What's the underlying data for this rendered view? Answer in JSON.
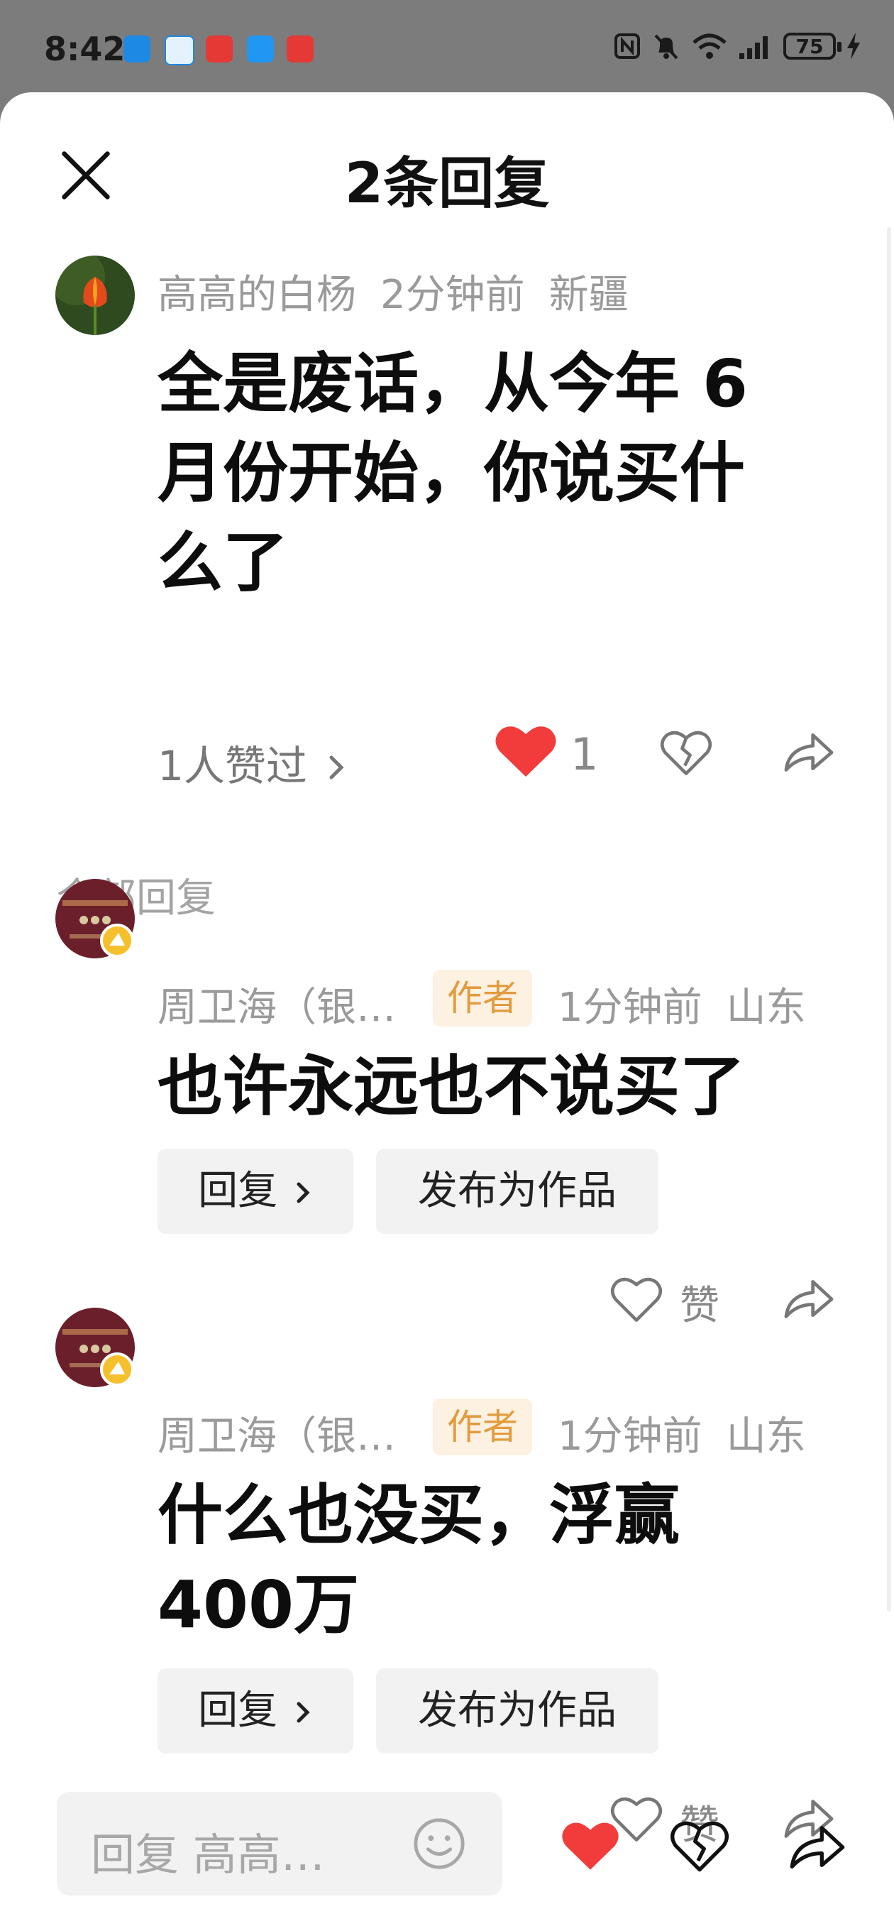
{
  "status": {
    "time": "8:42",
    "battery": "75"
  },
  "header": {
    "title": "2条回复"
  },
  "comment": {
    "author": "高高的白杨",
    "time": "2分钟前",
    "location": "新疆",
    "text_lines": [
      "全是废话，从今年 6",
      "月份开始，你说买什",
      "么了"
    ],
    "likers": "1人赞过",
    "like_count": "1"
  },
  "replies_section": {
    "label": "全部回复"
  },
  "replies": [
    {
      "author": "周卫海（银…",
      "badge": "作者",
      "time": "1分钟前",
      "location": "山东",
      "text_lines": [
        "也许永远也不说买了"
      ],
      "reply_label": "回复",
      "publish_label": "发布为作品",
      "like_label": "赞"
    },
    {
      "author": "周卫海（银…",
      "badge": "作者",
      "time": "1分钟前",
      "location": "山东",
      "text_lines": [
        "什么也没买，浮赢",
        "400万"
      ],
      "reply_label": "回复",
      "publish_label": "发布为作品",
      "like_label": "赞"
    }
  ],
  "input": {
    "placeholder": "回复 高高…"
  },
  "colors": {
    "like_red": "#f23c3c",
    "author_tag_bg": "#fdf1e1",
    "author_tag_text": "#e29b3d"
  }
}
